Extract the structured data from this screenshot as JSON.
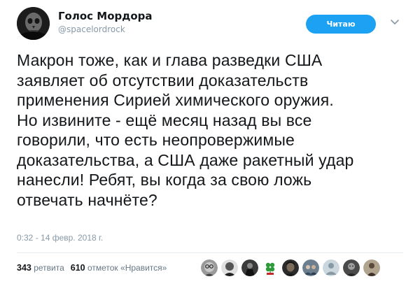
{
  "author": {
    "display_name": "Голос Мордора",
    "handle": "@spacelordrock",
    "avatar_icon": "skull-portrait-avatar"
  },
  "follow_button": {
    "label": "Читаю",
    "color": "#1da1f2"
  },
  "menu_icon": "chevron-down-icon",
  "tweet": {
    "text": "Макрон тоже, как и глава разведки США\nзаявляет об отсутствии доказательств\nприменения Сирией химического оружия.\nНо извините - ещё месяц назад вы все\nговорили, что есть неопровержимые\nдоказательства, а США даже ракетный удар\nнанесли! Ребят, вы когда за свою ложь\nотвечать начнёте?",
    "timestamp": "0:32 - 14 февр. 2018 г."
  },
  "stats": {
    "retweets_count": "343",
    "retweets_label": "ретвита",
    "likes_count": "610",
    "likes_label": "отметок «Нравится»"
  },
  "liker_avatars": [
    {
      "icon": "glasses-face-avatar"
    },
    {
      "icon": "bw-face-avatar"
    },
    {
      "icon": "dark-figure-avatar"
    },
    {
      "icon": "clover-avatar"
    },
    {
      "icon": "dark-portrait-avatar"
    },
    {
      "icon": "group-photo-avatar"
    },
    {
      "icon": "default-profile-avatar"
    },
    {
      "icon": "dark-face-avatar"
    },
    {
      "icon": "figure-avatar"
    }
  ]
}
